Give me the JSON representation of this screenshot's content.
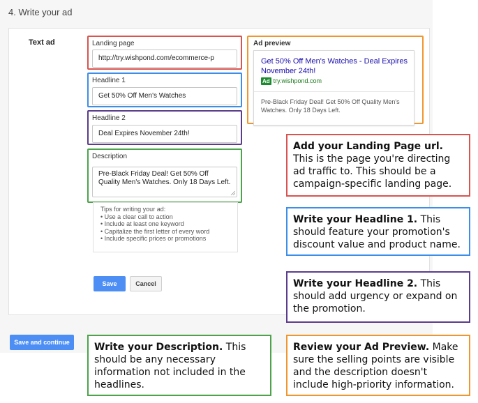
{
  "section_title": "4. Write your ad",
  "text_ad_label": "Text ad",
  "fields": {
    "landing_page": {
      "label": "Landing page",
      "value": "http://try.wishpond.com/ecommerce-p"
    },
    "headline1": {
      "label": "Headline 1",
      "value": "Get 50% Off Men's Watches"
    },
    "headline2": {
      "label": "Headline 2",
      "value": "Deal Expires November 24th!"
    },
    "description": {
      "label": "Description",
      "value": "Pre-Black Friday Deal! Get 50% Off Quality Men's Watches. Only 18 Days Left."
    }
  },
  "tips": {
    "title": "Tips for writing your ad:",
    "items": [
      "• Use a clear call to action",
      "• Include at least one keyword",
      "• Capitalize the first letter of every word",
      "• Include specific prices or promotions"
    ]
  },
  "buttons": {
    "save": "Save",
    "cancel": "Cancel",
    "save_continue": "Save and continue"
  },
  "preview": {
    "title": "Ad preview",
    "headline": "Get 50% Off Men's Watches - Deal Expires November 24th!",
    "badge": "Ad",
    "url": "try.wishpond.com",
    "description": "Pre-Black Friday Deal! Get 50% Off Quality Men's Watches. Only 18 Days Left."
  },
  "callouts": {
    "landing": {
      "bold": "Add your Landing Page url.",
      "text": " This is the page you're directing ad traffic to. This should be a campaign-specific landing page."
    },
    "headline1": {
      "bold": "Write your Headline 1.",
      "text": " This should feature your promotion's discount value and product name."
    },
    "headline2": {
      "bold": "Write your Headline 2.",
      "text": " This should add urgency or expand on the promotion."
    },
    "description": {
      "bold": "Write your Description.",
      "text": " This should be any necessary information not included in the headlines."
    },
    "preview": {
      "bold": "Review your Ad Preview.",
      "text": " Make sure the selling points are visible and the description doesn't include high-priority information."
    }
  },
  "colors": {
    "landing": "#d9534f",
    "headline1": "#3d8ee8",
    "headline2": "#5b3c8c",
    "description": "#4ca34a",
    "preview": "#f0962f",
    "button_primary": "#4d8ef5"
  }
}
